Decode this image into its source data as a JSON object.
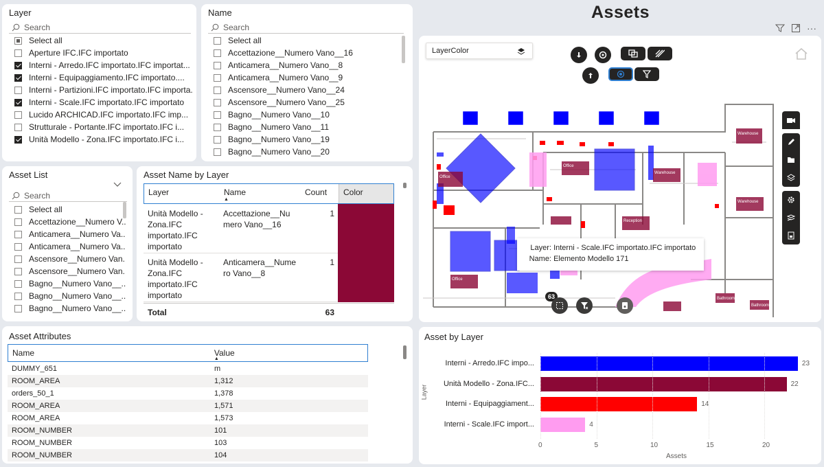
{
  "layer_slicer": {
    "title": "Layer",
    "search_placeholder": "Search",
    "items": [
      {
        "label": "Select all",
        "state": "partial"
      },
      {
        "label": "Aperture IFC.IFC importato",
        "state": "unchecked"
      },
      {
        "label": "Interni - Arredo.IFC importato.IFC importat...",
        "state": "checked"
      },
      {
        "label": "Interni - Equipaggiamento.IFC importato....",
        "state": "checked"
      },
      {
        "label": "Interni - Partizioni.IFC importato.IFC importa...",
        "state": "unchecked"
      },
      {
        "label": "Interni - Scale.IFC importato.IFC importato",
        "state": "checked"
      },
      {
        "label": "Lucido ARCHICAD.IFC importato.IFC imp...",
        "state": "unchecked"
      },
      {
        "label": "Strutturale - Portante.IFC importato.IFC i...",
        "state": "unchecked"
      },
      {
        "label": "Unità Modello - Zona.IFC importato.IFC i...",
        "state": "checked"
      }
    ]
  },
  "name_slicer": {
    "title": "Name",
    "search_placeholder": "Search",
    "items": [
      {
        "label": "Select all"
      },
      {
        "label": "Accettazione__Numero Vano__16"
      },
      {
        "label": "Anticamera__Numero Vano__8"
      },
      {
        "label": "Anticamera__Numero Vano__9"
      },
      {
        "label": "Ascensore__Numero Vano__24"
      },
      {
        "label": "Ascensore__Numero Vano__25"
      },
      {
        "label": "Bagno__Numero Vano__10"
      },
      {
        "label": "Bagno__Numero Vano__11"
      },
      {
        "label": "Bagno__Numero Vano__19"
      },
      {
        "label": "Bagno__Numero Vano__20"
      }
    ]
  },
  "asset_list": {
    "title": "Asset List",
    "search_placeholder": "Search",
    "items": [
      {
        "label": "Select all"
      },
      {
        "label": "Accettazione__Numero V..."
      },
      {
        "label": "Anticamera__Numero Va..."
      },
      {
        "label": "Anticamera__Numero Va..."
      },
      {
        "label": "Ascensore__Numero Van..."
      },
      {
        "label": "Ascensore__Numero Van..."
      },
      {
        "label": "Bagno__Numero Vano__..."
      },
      {
        "label": "Bagno__Numero Vano__..."
      },
      {
        "label": "Bagno__Numero Vano__..."
      }
    ]
  },
  "asset_name_by_layer": {
    "title": "Asset Name by Layer",
    "columns": [
      "Layer",
      "Name",
      "Count",
      "Color"
    ],
    "rows": [
      {
        "layer": [
          "Unità Modello -",
          "Zona.IFC",
          "importato.IFC",
          "importato"
        ],
        "name": [
          "Accettazione__Nu",
          "mero Vano__16"
        ],
        "count": "1",
        "color": "#8b0836"
      },
      {
        "layer": [
          "Unità Modello -",
          "Zona.IFC",
          "importato.IFC",
          "importato"
        ],
        "name": [
          "Anticamera__Nume",
          "ro Vano__8"
        ],
        "count": "1",
        "color": "#8b0836"
      }
    ],
    "total_label": "Total",
    "total_value": "63"
  },
  "asset_attributes": {
    "title": "Asset Attributes",
    "columns": [
      "Name",
      "Value"
    ],
    "rows": [
      [
        "DUMMY_651",
        "m"
      ],
      [
        "ROOM_AREA",
        "1,312"
      ],
      [
        "orders_50_1",
        "1,378"
      ],
      [
        "ROOM_AREA",
        "1,571"
      ],
      [
        "ROOM_AREA",
        "1,573"
      ],
      [
        "ROOM_NUMBER",
        "101"
      ],
      [
        "ROOM_NUMBER",
        "103"
      ],
      [
        "ROOM_NUMBER",
        "104"
      ]
    ]
  },
  "assets_panel": {
    "title": "Assets",
    "layer_dropdown": "LayerColor",
    "badge_count": "63",
    "tooltip": {
      "layer_key": "Layer:",
      "layer_value": "Interni - Scale.IFC importato.IFC importato",
      "name_key": "Name:",
      "name_value": "Elemento Modello 171"
    },
    "floorplan_labels": [
      "Office",
      "Office",
      "Warehouse",
      "Warehouse",
      "Warehouse",
      "Reception",
      "Office",
      "Bathroom",
      "Bathroom"
    ],
    "colors": {
      "blue": "#0000ff",
      "maroon": "#8b0836",
      "red": "#ff0000",
      "pink": "#ff9cf0"
    }
  },
  "chart_data": {
    "type": "bar",
    "title": "Asset by Layer",
    "xlabel": "Assets",
    "ylabel": "Layer",
    "orientation": "horizontal",
    "categories": [
      "Interni - Arredo.IFC impo...",
      "Unità Modello - Zona.IFC...",
      "Interni - Equipaggiament...",
      "Interni - Scale.IFC import..."
    ],
    "values": [
      23,
      22,
      14,
      4
    ],
    "colors": [
      "#0000ff",
      "#8b0836",
      "#ff0000",
      "#ff9cf0"
    ],
    "xlim": [
      0,
      23
    ],
    "xticks": [
      0,
      5,
      10,
      15,
      20
    ]
  }
}
